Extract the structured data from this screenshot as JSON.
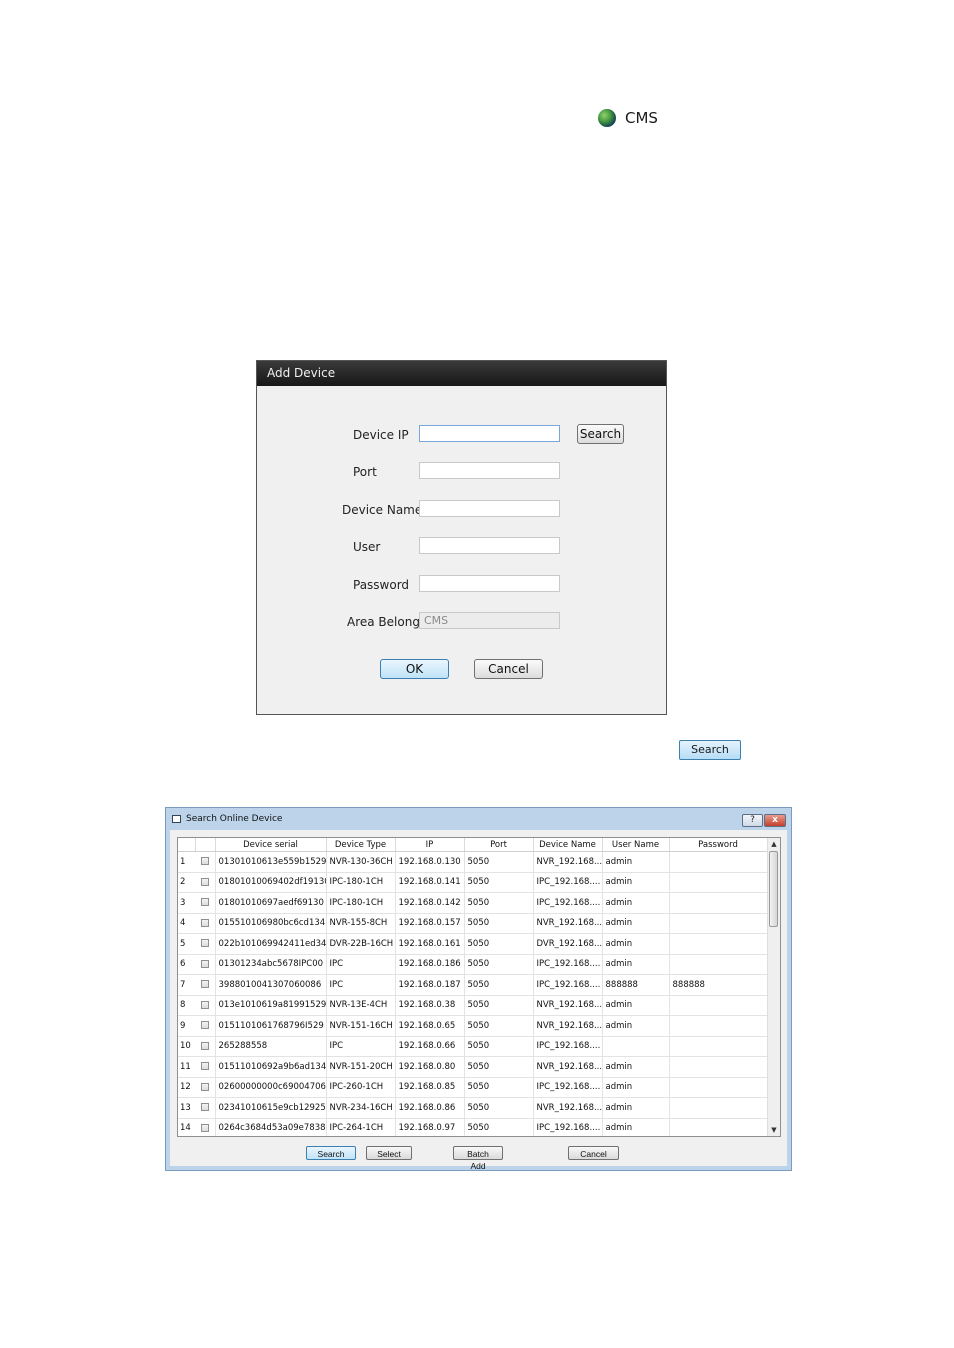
{
  "cms_node": {
    "icon": "globe-icon",
    "label": "CMS"
  },
  "add_device": {
    "title": "Add Device",
    "fields": {
      "device_ip": {
        "label": "Device IP",
        "value": ""
      },
      "port": {
        "label": "Port",
        "value": ""
      },
      "device_name": {
        "label": "Device Name",
        "value": ""
      },
      "user": {
        "label": "User",
        "value": ""
      },
      "password": {
        "label": "Password",
        "value": ""
      },
      "area_belong": {
        "label": "Area Belong",
        "value": "CMS"
      }
    },
    "search_label": "Search",
    "ok_label": "OK",
    "cancel_label": "Cancel"
  },
  "lone_search_button": "Search",
  "search_online": {
    "title": "Search Online Device",
    "help_label": "?",
    "close_label": "x",
    "columns": [
      "Device serial",
      "Device Type",
      "IP",
      "Port",
      "Device Name",
      "User Name",
      "Password"
    ],
    "rows": [
      {
        "n": "1",
        "serial": "01301010613e559b1529",
        "type": "NVR-130-36CH",
        "ip": "192.168.0.130",
        "port": "5050",
        "name": "NVR_192.168....",
        "user": "admin",
        "password": ""
      },
      {
        "n": "2",
        "serial": "01801010069402df19130",
        "type": "IPC-180-1CH",
        "ip": "192.168.0.141",
        "port": "5050",
        "name": "IPC_192.168....",
        "user": "admin",
        "password": ""
      },
      {
        "n": "3",
        "serial": "01801010697aedf69130",
        "type": "IPC-180-1CH",
        "ip": "192.168.0.142",
        "port": "5050",
        "name": "IPC_192.168....",
        "user": "admin",
        "password": ""
      },
      {
        "n": "4",
        "serial": "015510106980bc6cd134",
        "type": "NVR-155-8CH",
        "ip": "192.168.0.157",
        "port": "5050",
        "name": "NVR_192.168....",
        "user": "admin",
        "password": ""
      },
      {
        "n": "5",
        "serial": "022b101069942411ed34",
        "type": "DVR-22B-16CH",
        "ip": "192.168.0.161",
        "port": "5050",
        "name": "DVR_192.168....",
        "user": "admin",
        "password": ""
      },
      {
        "n": "6",
        "serial": "01301234abc5678IPC00",
        "type": "IPC",
        "ip": "192.168.0.186",
        "port": "5050",
        "name": "IPC_192.168....",
        "user": "admin",
        "password": ""
      },
      {
        "n": "7",
        "serial": "3988010041307060086",
        "type": "IPC",
        "ip": "192.168.0.187",
        "port": "5050",
        "name": "IPC_192.168....",
        "user": "888888",
        "password": "888888"
      },
      {
        "n": "8",
        "serial": "013e1010619a81991529",
        "type": "NVR-13E-4CH",
        "ip": "192.168.0.38",
        "port": "5050",
        "name": "NVR_192.168....",
        "user": "admin",
        "password": ""
      },
      {
        "n": "9",
        "serial": "0151101061768796I529",
        "type": "NVR-151-16CH",
        "ip": "192.168.0.65",
        "port": "5050",
        "name": "NVR_192.168....",
        "user": "admin",
        "password": ""
      },
      {
        "n": "10",
        "serial": "265288558",
        "type": "IPC",
        "ip": "192.168.0.66",
        "port": "5050",
        "name": "IPC_192.168....",
        "user": "",
        "password": ""
      },
      {
        "n": "11",
        "serial": "01511010692a9b6ad134",
        "type": "NVR-151-20CH",
        "ip": "192.168.0.80",
        "port": "5050",
        "name": "NVR_192.168....",
        "user": "admin",
        "password": ""
      },
      {
        "n": "12",
        "serial": "02600000000c69004706",
        "type": "IPC-260-1CH",
        "ip": "192.168.0.85",
        "port": "5050",
        "name": "IPC_192.168....",
        "user": "admin",
        "password": ""
      },
      {
        "n": "13",
        "serial": "02341010615e9cb12925",
        "type": "NVR-234-16CH",
        "ip": "192.168.0.86",
        "port": "5050",
        "name": "NVR_192.168....",
        "user": "admin",
        "password": ""
      },
      {
        "n": "14",
        "serial": "0264c3684d53a09e7838",
        "type": "IPC-264-1CH",
        "ip": "192.168.0.97",
        "port": "5050",
        "name": "IPC_192.168....",
        "user": "admin",
        "password": ""
      }
    ],
    "buttons": {
      "search": "Search",
      "select": "Select",
      "batch_add": "Batch Add",
      "cancel": "Cancel"
    }
  }
}
